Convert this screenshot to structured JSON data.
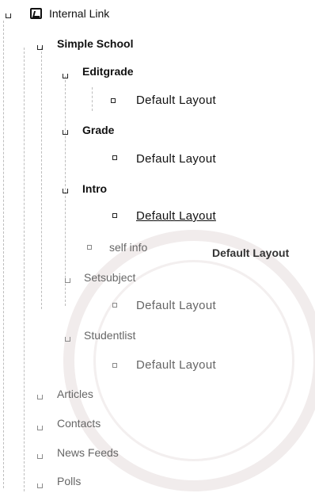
{
  "tree": {
    "root": {
      "label": "Internal Link",
      "icon": "internal-link-icon"
    },
    "school": {
      "label": "Simple School"
    },
    "editgrade": {
      "label": "Editgrade",
      "layout": "Default Layout"
    },
    "grade": {
      "label": "Grade",
      "layout": "Default Layout"
    },
    "intro": {
      "label": "Intro",
      "layout": "Default Layout"
    },
    "selfinfo": {
      "label": "self info"
    },
    "setsubject": {
      "label": "Setsubject",
      "layout": "Default Layout"
    },
    "studentlist": {
      "label": "Studentlist",
      "layout": "Default Layout"
    },
    "articles": {
      "label": "Articles"
    },
    "contacts": {
      "label": "Contacts"
    },
    "newsfeeds": {
      "label": "News Feeds"
    },
    "polls": {
      "label": "Polls"
    }
  },
  "tooltip": {
    "text": "Default Layout"
  }
}
